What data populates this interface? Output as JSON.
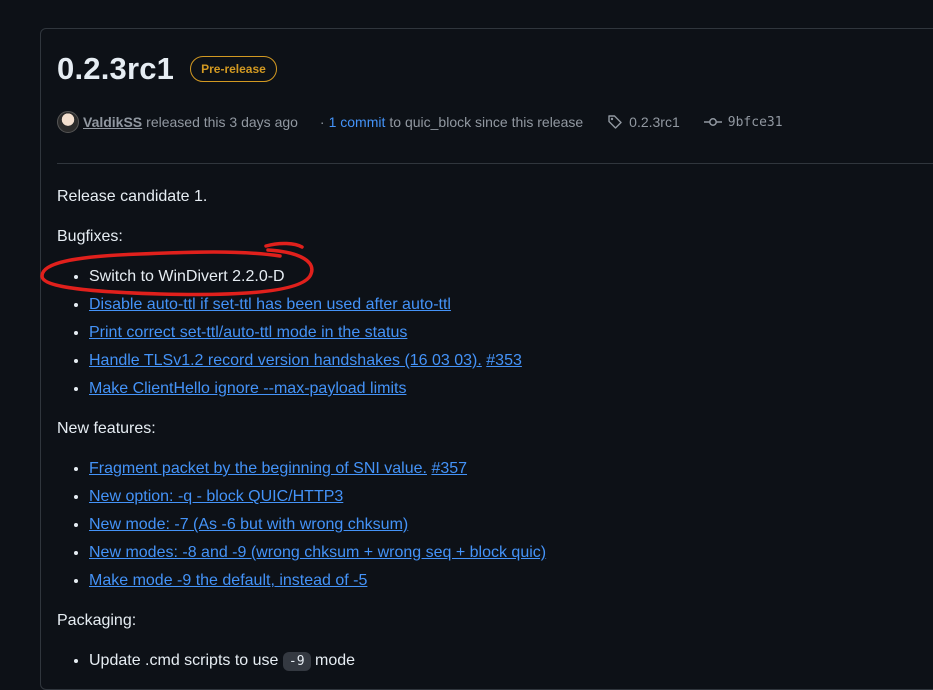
{
  "release": {
    "title": "0.2.3rc1",
    "badge": "Pre-release"
  },
  "meta": {
    "author": "ValdikSS",
    "released_text": "released this 3 days ago",
    "separator": "·",
    "commit_count": "1 commit",
    "commit_suffix": "to quic_block since this release",
    "tag": "0.2.3rc1",
    "commit_hash": "9bfce31"
  },
  "notes": {
    "intro": "Release candidate 1.",
    "bugfixes_heading": "Bugfixes:",
    "bugfixes": [
      {
        "text": "Switch to WinDivert 2.2.0-D",
        "link": false
      },
      {
        "text": "Disable auto-ttl if set-ttl has been used after auto-ttl",
        "link": true
      },
      {
        "text": "Print correct set-ttl/auto-ttl mode in the status",
        "link": true
      },
      {
        "text": "Handle TLSv1.2 record version handshakes (16 03 03).",
        "link": true,
        "ref": "#353"
      },
      {
        "text": "Make ClientHello ignore --max-payload limits",
        "link": true
      }
    ],
    "features_heading": "New features:",
    "features": [
      {
        "text": "Fragment packet by the beginning of SNI value.",
        "ref": "#357"
      },
      {
        "text": "New option: -q - block QUIC/HTTP3"
      },
      {
        "text": "New mode: -7 (As -6 but with wrong chksum)"
      },
      {
        "text": "New modes: -8 and -9 (wrong chksum + wrong seq + block quic)"
      },
      {
        "text": "Make mode -9 the default, instead of -5"
      }
    ],
    "packaging_heading": "Packaging:",
    "packaging_item_prefix": "Update .cmd scripts to use",
    "packaging_item_code": "-9",
    "packaging_item_suffix": "mode"
  },
  "colors": {
    "background": "#0d1117",
    "link": "#4493f8",
    "badge": "#d29922",
    "annotation": "#e0201c"
  }
}
